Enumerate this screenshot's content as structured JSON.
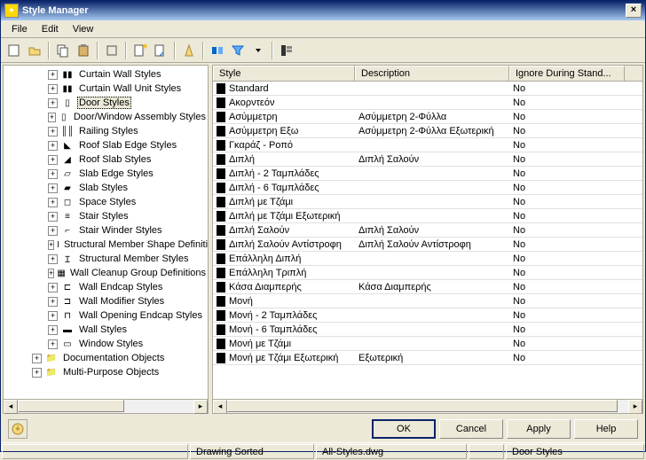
{
  "window": {
    "title": "Style Manager"
  },
  "menu": {
    "file": "File",
    "edit": "Edit",
    "view": "View"
  },
  "tree": {
    "items": [
      {
        "label": "Curtain Wall Styles",
        "indent": 50,
        "icon": "▮▮"
      },
      {
        "label": "Curtain Wall Unit Styles",
        "indent": 50,
        "icon": "▮▮"
      },
      {
        "label": "Door Styles",
        "indent": 50,
        "icon": "▯",
        "selected": true
      },
      {
        "label": "Door/Window Assembly Styles",
        "indent": 50,
        "icon": "▯"
      },
      {
        "label": "Railing Styles",
        "indent": 50,
        "icon": "║║"
      },
      {
        "label": "Roof Slab Edge Styles",
        "indent": 50,
        "icon": "◣"
      },
      {
        "label": "Roof Slab Styles",
        "indent": 50,
        "icon": "◢"
      },
      {
        "label": "Slab Edge Styles",
        "indent": 50,
        "icon": "▱"
      },
      {
        "label": "Slab Styles",
        "indent": 50,
        "icon": "▰"
      },
      {
        "label": "Space Styles",
        "indent": 50,
        "icon": "◻"
      },
      {
        "label": "Stair Styles",
        "indent": 50,
        "icon": "≡"
      },
      {
        "label": "Stair Winder Styles",
        "indent": 50,
        "icon": "⌐"
      },
      {
        "label": "Structural Member Shape Definitions",
        "indent": 50,
        "icon": "I"
      },
      {
        "label": "Structural Member Styles",
        "indent": 50,
        "icon": "Ɪ"
      },
      {
        "label": "Wall Cleanup Group Definitions",
        "indent": 50,
        "icon": "▦"
      },
      {
        "label": "Wall Endcap Styles",
        "indent": 50,
        "icon": "⊏"
      },
      {
        "label": "Wall Modifier Styles",
        "indent": 50,
        "icon": "⊐"
      },
      {
        "label": "Wall Opening Endcap Styles",
        "indent": 50,
        "icon": "⊓"
      },
      {
        "label": "Wall Styles",
        "indent": 50,
        "icon": "▬"
      },
      {
        "label": "Window Styles",
        "indent": 50,
        "icon": "▭"
      },
      {
        "label": "Documentation Objects",
        "indent": 32,
        "icon": "📁",
        "folder": true
      },
      {
        "label": "Multi-Purpose Objects",
        "indent": 32,
        "icon": "📁",
        "folder": true
      }
    ]
  },
  "grid": {
    "headers": {
      "c0": "Style",
      "c1": "Description",
      "c2": "Ignore During Stand..."
    },
    "rows": [
      {
        "style": "Standard",
        "desc": "",
        "ignore": "No"
      },
      {
        "style": "Ακορντεόν",
        "desc": "",
        "ignore": "No"
      },
      {
        "style": "Ασύμμετρη",
        "desc": "Ασύμμετρη 2-Φύλλα",
        "ignore": "No"
      },
      {
        "style": "Ασύμμετρη Εξω",
        "desc": "Ασύμμετρη 2-Φύλλα Εξωτερική",
        "ignore": "No"
      },
      {
        "style": "Γκαράζ - Ροπό",
        "desc": "",
        "ignore": "No"
      },
      {
        "style": "Διπλή",
        "desc": "Διπλή Σαλούν",
        "ignore": "No"
      },
      {
        "style": "Διπλή - 2 Ταμπλάδες",
        "desc": "",
        "ignore": "No"
      },
      {
        "style": "Διπλή - 6 Ταμπλάδες",
        "desc": "",
        "ignore": "No"
      },
      {
        "style": "Διπλή με Τζάμι",
        "desc": "",
        "ignore": "No"
      },
      {
        "style": "Διπλή με Τζάμι Εξωτερική",
        "desc": "",
        "ignore": "No"
      },
      {
        "style": "Διπλή Σαλούν",
        "desc": "Διπλή Σαλούν",
        "ignore": "No"
      },
      {
        "style": "Διπλή Σαλούν Αντίστροφη",
        "desc": "Διπλή Σαλούν Αντίστροφη",
        "ignore": "No"
      },
      {
        "style": "Επάλληλη Διπλή",
        "desc": "",
        "ignore": "No"
      },
      {
        "style": "Επάλληλη Τριπλή",
        "desc": "",
        "ignore": "No"
      },
      {
        "style": "Κάσα Διαμπερής",
        "desc": "Κάσα Διαμπερής",
        "ignore": "No"
      },
      {
        "style": "Μονή",
        "desc": "",
        "ignore": "No"
      },
      {
        "style": "Μονή - 2 Ταμπλάδες",
        "desc": "",
        "ignore": "No"
      },
      {
        "style": "Μονή - 6 Ταμπλάδες",
        "desc": "",
        "ignore": "No"
      },
      {
        "style": "Μονή με Τζάμι",
        "desc": "",
        "ignore": "No"
      },
      {
        "style": "Μονή με Τζάμι Εξωτερική",
        "desc": "Εξωτερική",
        "ignore": "No"
      }
    ]
  },
  "buttons": {
    "ok": "OK",
    "cancel": "Cancel",
    "apply": "Apply",
    "help": "Help"
  },
  "status": {
    "s1": "",
    "s2": "Drawing Sorted",
    "s3": "All-Styles.dwg",
    "s4": "",
    "s5": "Door Styles"
  }
}
